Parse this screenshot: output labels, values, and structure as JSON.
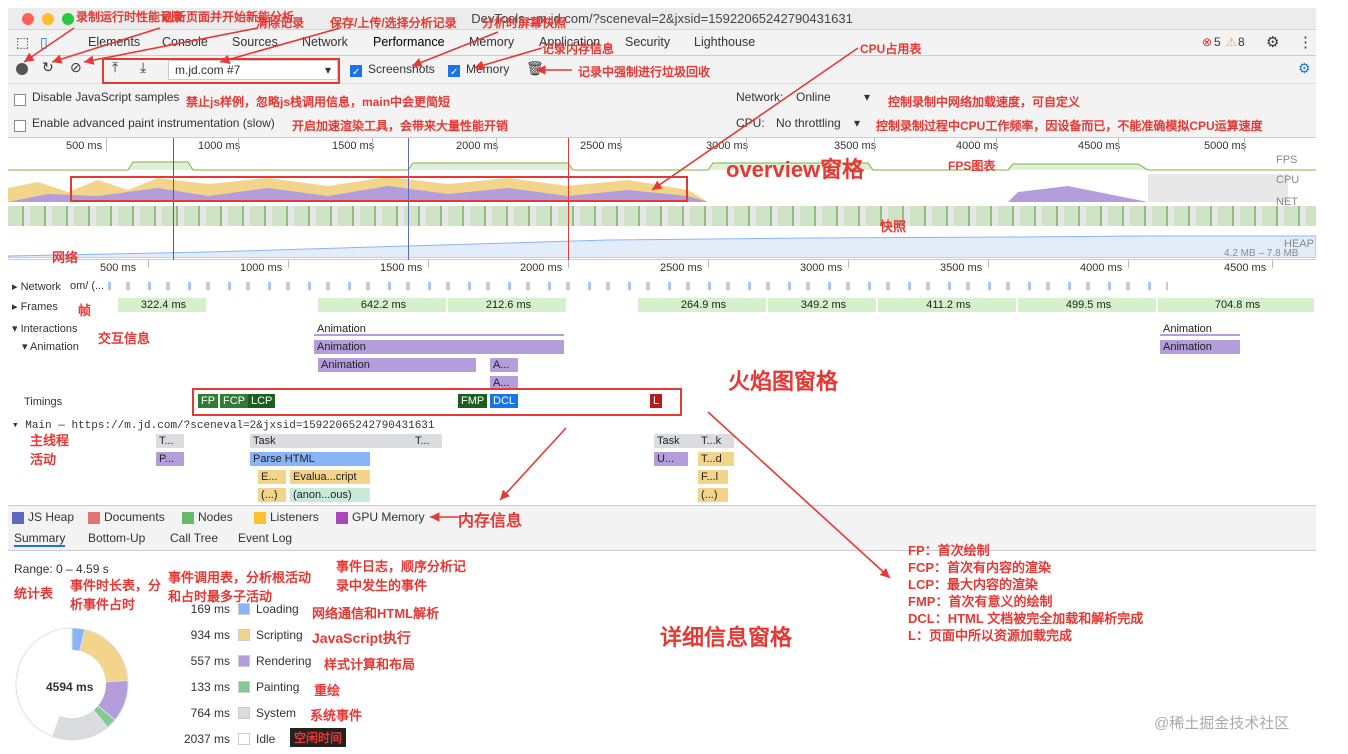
{
  "window": {
    "title": "DevTools - m.jd.com/?sceneval=2&jxsid=15922065242790431631"
  },
  "tabs": [
    "Elements",
    "Console",
    "Sources",
    "Network",
    "Performance",
    "Memory",
    "Application",
    "Security",
    "Lighthouse"
  ],
  "badges": {
    "errors": "5",
    "warnings": "8"
  },
  "toolbar": {
    "profile_select": "m.jd.com #7",
    "screenshots": "Screenshots",
    "memory": "Memory"
  },
  "settings": {
    "disable_js": "Disable JavaScript samples",
    "advanced_paint": "Enable advanced paint instrumentation (slow)",
    "network_label": "Network:",
    "network_value": "Online",
    "cpu_label": "CPU:",
    "cpu_value": "No throttling"
  },
  "overview": {
    "ticks": [
      "500 ms",
      "1000 ms",
      "1500 ms",
      "2000 ms",
      "2500 ms",
      "3000 ms",
      "3500 ms",
      "4000 ms",
      "4500 ms",
      "5000 ms"
    ],
    "lanes": [
      "FPS",
      "CPU",
      "NET"
    ],
    "heap": "4.2 MB – 7.8 MB",
    "heap_label": "HEAP"
  },
  "flame": {
    "ticks": [
      "500 ms",
      "1000 ms",
      "1500 ms",
      "2000 ms",
      "2500 ms",
      "3000 ms",
      "3500 ms",
      "4000 ms",
      "4500 ms"
    ],
    "network_label": "Network",
    "network_rest": "om/ (...",
    "frames_label": "Frames",
    "frames": [
      "322.4 ms",
      "642.2 ms",
      "212.6 ms",
      "264.9 ms",
      "349.2 ms",
      "411.2 ms",
      "499.5 ms",
      "704.8 ms"
    ],
    "interactions_label": "Interactions",
    "animation_label": "Animation",
    "anim_bars": [
      "Animation",
      "Animation",
      "Animation",
      "A...",
      "A...",
      "Animation",
      "Animation"
    ],
    "timings_label": "Timings",
    "timings": [
      "FP",
      "FCP",
      "LCP",
      "FMP",
      "DCL",
      "L"
    ],
    "main_label": "Main — https://m.jd.com/?sceneval=2&jxsid=15922065242790431631",
    "main_bars": [
      "T...",
      "Task",
      "T...",
      "Task",
      "T...k",
      "P...",
      "Parse HTML",
      "U...",
      "T...d",
      "E...",
      "Evalua...cript",
      "F...l",
      "(...)",
      "(anon...ous)",
      "(...)"
    ]
  },
  "legend": [
    "JS Heap",
    "Documents",
    "Nodes",
    "Listeners",
    "GPU Memory"
  ],
  "detail_tabs": [
    "Summary",
    "Bottom-Up",
    "Call Tree",
    "Event Log"
  ],
  "summary": {
    "range": "Range: 0 – 4.59 s",
    "total": "4594 ms",
    "rows": [
      {
        "ms": "169 ms",
        "label": "Loading",
        "color": "#8ab4f8"
      },
      {
        "ms": "934 ms",
        "label": "Scripting",
        "color": "#f2d48b"
      },
      {
        "ms": "557 ms",
        "label": "Rendering",
        "color": "#b39ddb"
      },
      {
        "ms": "133 ms",
        "label": "Painting",
        "color": "#81c995"
      },
      {
        "ms": "764 ms",
        "label": "System",
        "color": "#dadce0"
      },
      {
        "ms": "2037 ms",
        "label": "Idle",
        "color": "#ffffff"
      }
    ]
  },
  "annotations": {
    "record": "录制运行时性能记录",
    "reload": "刷新页面并开始新能分析",
    "clear": "清除记录",
    "save": "保存/上传/选择分析记录",
    "screenshot": "分析时屏幕快照",
    "memory": "记录内存信息",
    "gc": "记录中强制进行垃圾回收",
    "cpu": "CPU占用表",
    "disable_js": "禁止js样例，忽略js栈调用信息，main中会更简短",
    "paint": "开启加速渲染工具，会带来大量性能开销",
    "network_throttle": "控制录制中网络加载速度，可自定义",
    "cpu_throttle": "控制录制过程中CPU工作频率，因设备而已，不能准确模拟CPU运算速度",
    "overview": "overview窗格",
    "fps": "FPS图表",
    "snapshot": "快照",
    "net": "网络",
    "frames": "帧",
    "interactions": "交互信息",
    "flame": "火焰图窗格",
    "main": "主线程活动",
    "memory_info": "内存信息",
    "stats": "统计表",
    "bottom_up": "事件时长表，分析事件占时",
    "call_tree": "事件调用表，分析根活动和占时最多子活动",
    "event_log": "事件日志，顺序分析记录中发生的事件",
    "loading": "网络通信和HTML解析",
    "scripting": "JavaScript执行",
    "rendering": "样式计算和布局",
    "painting": "重绘",
    "system": "系统事件",
    "idle": "空闲时间",
    "detail": "详细信息窗格",
    "defs": [
      "FP：首次绘制",
      "FCP：首次有内容的渲染",
      "LCP：最大内容的渲染",
      "FMP：首次有意义的绘制",
      "DCL：HTML 文档被完全加载和解析完成",
      "L：页面中所以资源加载完成"
    ],
    "watermark": "@稀土掘金技术社区"
  }
}
